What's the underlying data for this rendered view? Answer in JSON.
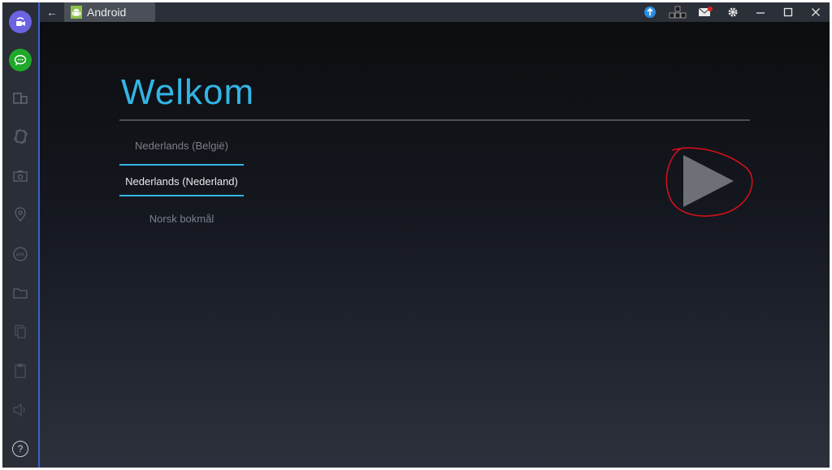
{
  "window": {
    "tab_title": "Android"
  },
  "page": {
    "title": "Welkom",
    "languages": [
      {
        "label": "Nederlands (België)",
        "selected": false
      },
      {
        "label": "Nederlands (Nederland)",
        "selected": true
      },
      {
        "label": "Norsk bokmål",
        "selected": false
      }
    ]
  },
  "sidebar": {
    "items": [
      "video-call-icon",
      "chat-icon",
      "multi-window-icon",
      "rotate-icon",
      "screenshot-icon",
      "location-icon",
      "apk-icon",
      "folder-icon",
      "copy-icon",
      "paste-icon",
      "volume-icon"
    ],
    "help_label": "?"
  },
  "colors": {
    "accent": "#33b5e5",
    "annotation": "#d0101a",
    "sidebar_border": "#3c5fd0"
  }
}
